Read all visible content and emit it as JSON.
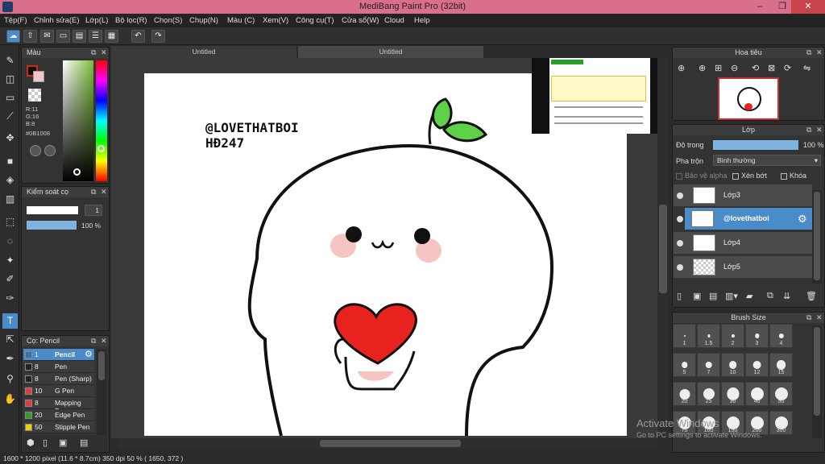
{
  "window": {
    "title": "MediBang Paint Pro (32bit)"
  },
  "menu": [
    "Tệp(F)",
    "Chỉnh sửa(E)",
    "Lớp(L)",
    "Bộ lọc(R)",
    "Chọn(S)",
    "Chụp(N)",
    "Màu (C)",
    "Xem(V)",
    "Công cụ(T)",
    "Cửa sổ(W)",
    "Cloud",
    "Help"
  ],
  "tabs": [
    "Untitled",
    "Untitled"
  ],
  "color_panel": {
    "title": "Màu",
    "r": "R:11",
    "g": "G:16",
    "b": "B:8",
    "hex": "#0B1008",
    "fg": "#0B1008"
  },
  "control_panel": {
    "title": "Kiểm soát cọ",
    "size": "1",
    "opacity": "100 %"
  },
  "brush_panel": {
    "title": "Cọ: Pencil",
    "items": [
      {
        "size": "1",
        "name": "Pencil",
        "color": "#3a6fb0"
      },
      {
        "size": "8",
        "name": "Pen",
        "color": "#222222"
      },
      {
        "size": "8",
        "name": "Pen (Sharp)",
        "color": "#222222"
      },
      {
        "size": "10",
        "name": "G Pen",
        "color": "#e03a3a"
      },
      {
        "size": "8",
        "name": "Mapping Pen",
        "color": "#e03a3a"
      },
      {
        "size": "20",
        "name": "Edge Pen",
        "color": "#2aa02a"
      },
      {
        "size": "50",
        "name": "Stipple Pen",
        "color": "#e8d400"
      }
    ]
  },
  "artwork": {
    "watermark_line1": "@LOVETHATBOI",
    "watermark_line2": "HĐ247"
  },
  "navigator": {
    "title": "Hoa tiêu"
  },
  "layer_panel": {
    "title": "Lớp",
    "opacity_label": "Độ trong",
    "opacity_value": "100 %",
    "blend_label": "Pha trộn",
    "blend_value": "Bình thường",
    "protect_alpha": "Bảo vệ alpha",
    "clipping": "Xén bớt",
    "lock": "Khóa",
    "layers": [
      "Lớp3",
      "@lovethatboi",
      "Lớp4",
      "Lớp5"
    ]
  },
  "brush_size": {
    "title": "Brush Size",
    "sizes": [
      "1",
      "1.5",
      "2",
      "3",
      "4",
      "5",
      "7",
      "10",
      "12",
      "15",
      "20",
      "25",
      "30",
      "40",
      "50",
      "70",
      "100",
      "150",
      "200",
      "300"
    ]
  },
  "status": {
    "text": "1600 * 1200 pixel   (11.6 * 8.7cm)   350 dpi   50 %   ( 1650, 372 )"
  },
  "activation": {
    "line1": "Activate Windows",
    "line2": "Go to PC settings to activate Windows."
  },
  "colors": {
    "accent": "#4a8cc9",
    "titlebar": "#d96f8a"
  }
}
